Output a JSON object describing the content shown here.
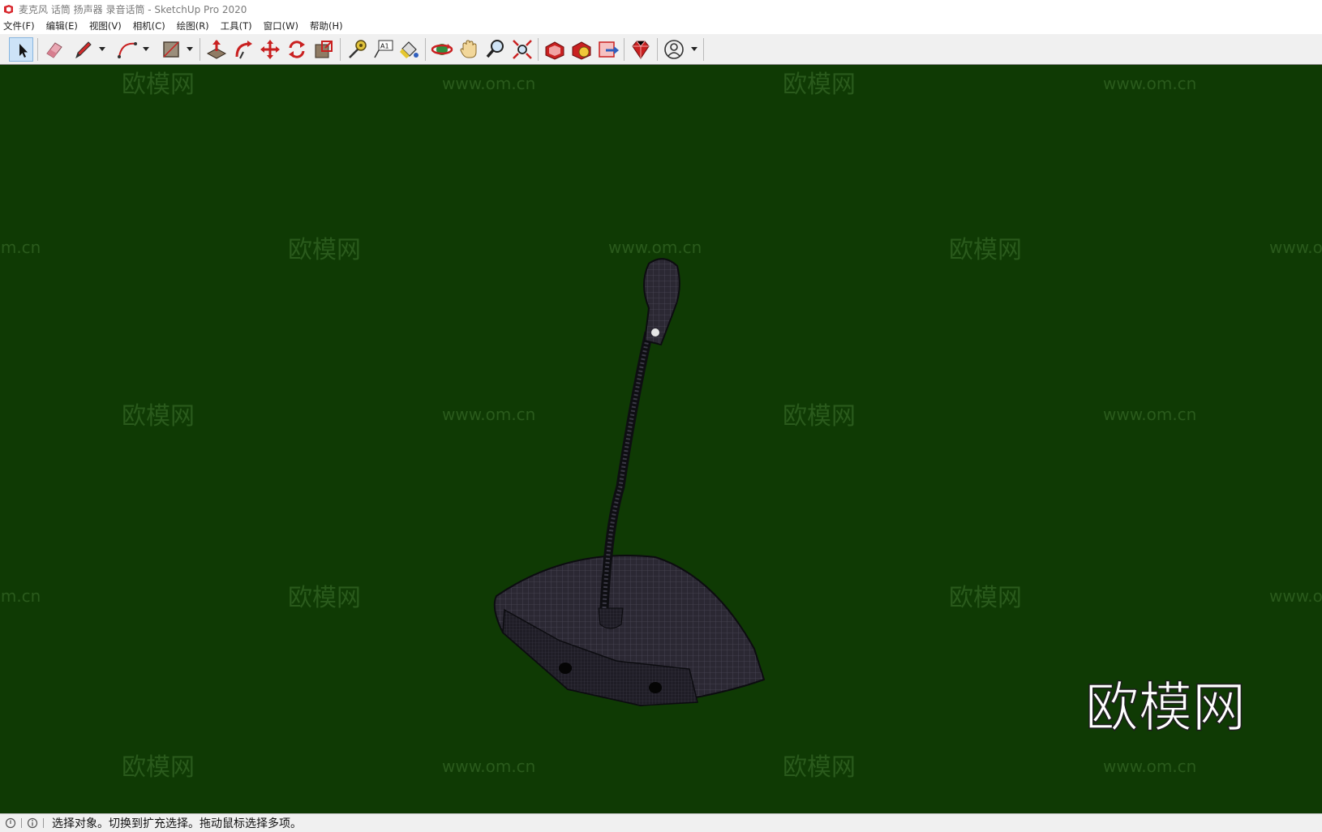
{
  "window": {
    "title": "麦克风 话筒 扬声器 录音话筒 - SketchUp Pro 2020",
    "app_icon": "sketchup-logo-icon"
  },
  "menu": {
    "items": [
      {
        "label": "文件(F)"
      },
      {
        "label": "编辑(E)"
      },
      {
        "label": "视图(V)"
      },
      {
        "label": "相机(C)"
      },
      {
        "label": "绘图(R)"
      },
      {
        "label": "工具(T)"
      },
      {
        "label": "窗口(W)"
      },
      {
        "label": "帮助(H)"
      }
    ]
  },
  "toolbar": {
    "tools": [
      {
        "icon": "select-arrow-icon",
        "active": true
      },
      {
        "icon": "eraser-icon"
      },
      {
        "icon": "pencil-line-icon"
      },
      {
        "icon": "arc-icon"
      },
      {
        "icon": "rectangle-shape-icon"
      },
      {
        "icon": "push-pull-icon"
      },
      {
        "icon": "follow-me-icon"
      },
      {
        "icon": "move-icon"
      },
      {
        "icon": "rotate-icon"
      },
      {
        "icon": "scale-icon"
      },
      {
        "icon": "tape-measure-icon"
      },
      {
        "icon": "text-label-icon"
      },
      {
        "icon": "paint-bucket-icon"
      },
      {
        "icon": "orbit-icon"
      },
      {
        "icon": "pan-hand-icon"
      },
      {
        "icon": "zoom-icon"
      },
      {
        "icon": "zoom-extents-icon"
      },
      {
        "icon": "warehouse-icon"
      },
      {
        "icon": "extension-warehouse-icon"
      },
      {
        "icon": "send-to-layout-icon"
      },
      {
        "icon": "ruby-gem-icon"
      },
      {
        "icon": "user-account-icon"
      }
    ]
  },
  "viewport": {
    "background_color": "#0f3a04",
    "watermark_logo": "欧模网",
    "watermark_url": "www.om.cn",
    "brand_logo_text": "欧模网",
    "model_name": "conference-microphone-model"
  },
  "status": {
    "text": "选择对象。切换到扩充选择。拖动鼠标选择多项。",
    "icons": [
      "geo-location-icon",
      "info-icon"
    ]
  }
}
